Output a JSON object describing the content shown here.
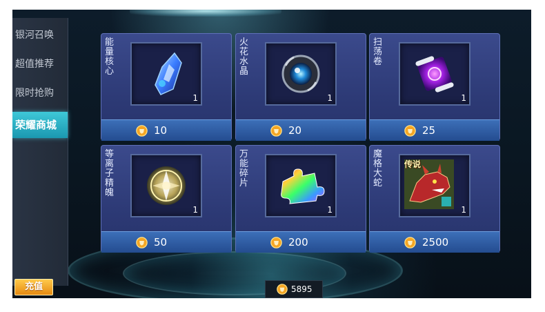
{
  "sidebar": {
    "items": [
      {
        "label": "银河召唤"
      },
      {
        "label": "超值推荐"
      },
      {
        "label": "限时抢购"
      },
      {
        "label": "荣耀商城"
      }
    ],
    "recharge_label": "充值"
  },
  "shop": {
    "items": [
      {
        "name": "能量核心",
        "quantity": "1",
        "price": "10",
        "icon": "energy-core-icon"
      },
      {
        "name": "火花水晶",
        "quantity": "1",
        "price": "20",
        "icon": "spark-crystal-icon"
      },
      {
        "name": "扫荡卷",
        "quantity": "1",
        "price": "25",
        "icon": "sweep-scroll-icon"
      },
      {
        "name": "等离子精魄",
        "quantity": "1",
        "price": "50",
        "icon": "plasma-spirit-icon"
      },
      {
        "name": "万能碎片",
        "quantity": "1",
        "price": "200",
        "icon": "universal-fragment-icon"
      },
      {
        "name": "魔格大蛇",
        "quantity": "1",
        "price": "2500",
        "icon": "dragon-icon",
        "badge": "传说"
      }
    ]
  },
  "wallet": {
    "balance": "5895",
    "currency_icon": "honor-coin-icon"
  },
  "colors": {
    "active_tab": "#2fb4c8",
    "card_bg": "#34428a",
    "price_bar": "#2e5ca4",
    "coin": "#f5a623",
    "recharge": "#f0a020"
  }
}
